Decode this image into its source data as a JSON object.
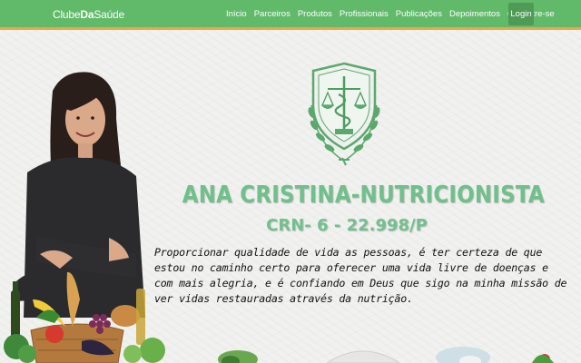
{
  "navbar": {
    "brand_prefix": "Clube",
    "brand_bold": "Da",
    "brand_suffix": "Saúde",
    "items": [
      {
        "label": "Início"
      },
      {
        "label": "Parceiros"
      },
      {
        "label": "Produtos"
      },
      {
        "label": "Profissionais"
      },
      {
        "label": "Publicações"
      },
      {
        "label": "Depoimentos"
      },
      {
        "label": "Cadastre-se"
      }
    ],
    "login_label": "Login"
  },
  "hero": {
    "title": "ANA CRISTINA-NUTRICIONISTA",
    "registration": "CRN- 6 - 22.998/P",
    "mission": "Proporcionar qualidade de vida as pessoas, é ter certeza de que estou no caminho certo para oferecer uma vida livre de doenças e com mais alegria, e é confiando em Deus que sigo na minha missão de ver vidas restauradas através da nutrição."
  },
  "colors": {
    "navbar_bg": "#61b96a",
    "accent_orange": "#e9a84a",
    "title_green": "#6fc08a",
    "login_bg": "#4e9a56"
  },
  "icons": {
    "emblem": "nutrition-scale-caduceus-emblem-icon"
  }
}
